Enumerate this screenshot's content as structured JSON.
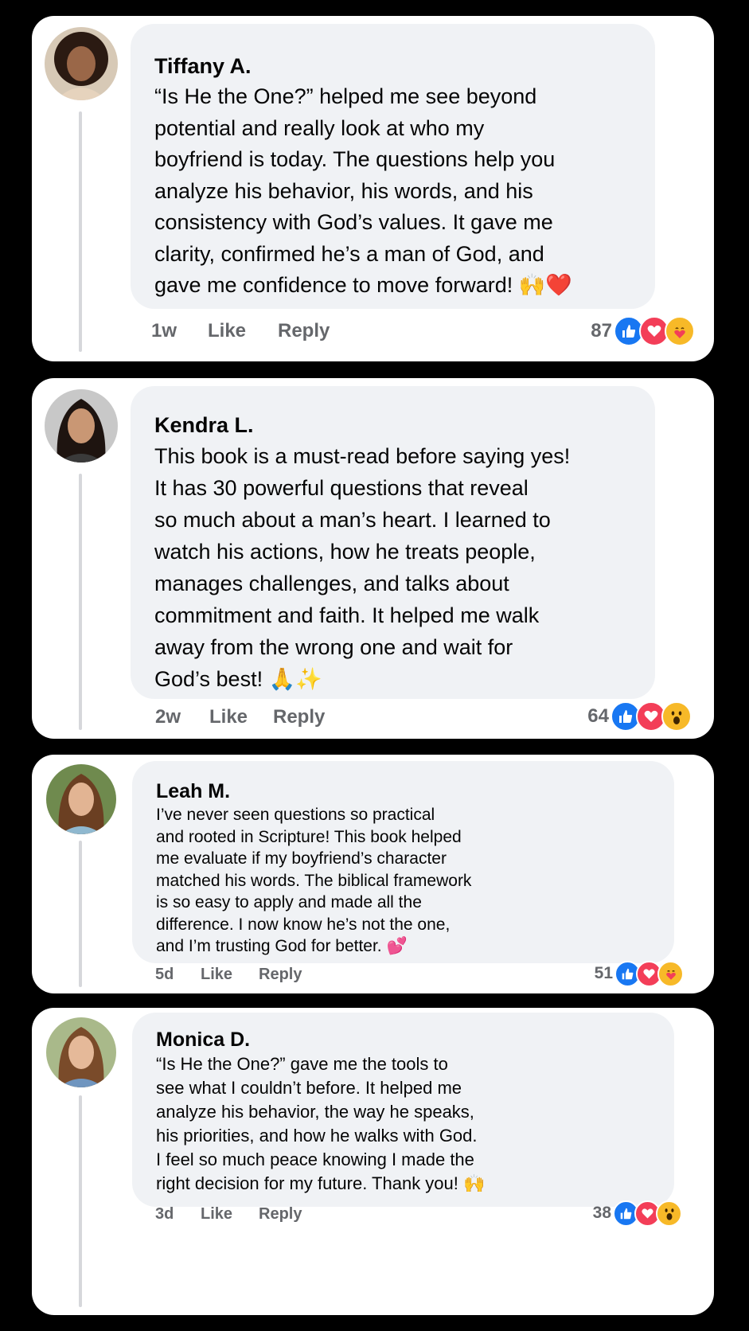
{
  "comments": [
    {
      "name": "Tiffany A.",
      "text": "“Is He the One?” helped me see beyond\npotential and really look at who my\nboyfriend is today. The questions help you\nanalyze his behavior, his words, and his\nconsistency with God’s values. It gave me\nclarity, confirmed he’s a man of God, and\ngave me confidence to move forward! 🙌❤️",
      "time": "1w",
      "like_label": "Like",
      "reply_label": "Reply",
      "reaction_count": "87",
      "reactions": [
        "like-icon",
        "love-icon",
        "care-icon"
      ]
    },
    {
      "name": "Kendra L.",
      "text": "This book is a must-read before saying yes!\nIt has 30 powerful questions that reveal\nso much about a man’s heart. I learned to\nwatch his actions, how he treats people,\nmanages challenges, and talks about\ncommitment and faith. It helped me walk\naway from the wrong one and wait for\nGod’s best! 🙏✨",
      "time": "2w",
      "like_label": "Like",
      "reply_label": "Reply",
      "reaction_count": "64",
      "reactions": [
        "like-icon",
        "love-icon",
        "wow-icon"
      ]
    },
    {
      "name": "Leah M.",
      "text": "I’ve never seen questions so practical\nand rooted in Scripture! This book helped\nme evaluate if my boyfriend’s character\nmatched his words. The biblical framework\nis so easy to apply and made all the\ndifference. I now know he’s not the one,\nand I’m trusting God for better. 💕",
      "time": "5d",
      "like_label": "Like",
      "reply_label": "Reply",
      "reaction_count": "51",
      "reactions": [
        "like-icon",
        "love-icon",
        "care-icon"
      ]
    },
    {
      "name": "Monica D.",
      "text": "“Is He the One?” gave me the tools to\nsee what I couldn’t before. It helped me\nanalyze his behavior, the way he speaks,\nhis priorities, and how he walks with God.\nI feel so much peace knowing I made the\nright decision for my future. Thank you! 🙌",
      "time": "3d",
      "like_label": "Like",
      "reply_label": "Reply",
      "reaction_count": "38",
      "reactions": [
        "like-icon",
        "love-icon",
        "wow-icon"
      ]
    }
  ],
  "colors": {
    "background": "#000000",
    "card": "#ffffff",
    "bubble": "#f0f2f5",
    "meta_text": "#65676b",
    "like_blue": "#1877f2",
    "love_red": "#f33e58",
    "emoji_yellow": "#f7b928"
  }
}
